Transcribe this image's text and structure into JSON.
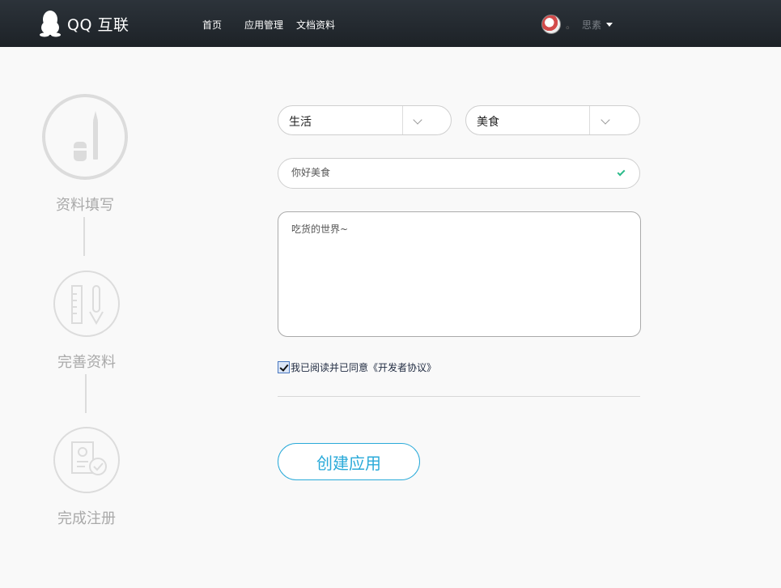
{
  "header": {
    "logo_text": "QQ 互联",
    "nav": [
      "首页",
      "应用管理",
      "文档资料"
    ],
    "user_dot": "。",
    "user_name": "思素"
  },
  "steps": [
    {
      "label": "资料填写",
      "active": true
    },
    {
      "label": "完善资料",
      "active": false
    },
    {
      "label": "完成注册",
      "active": false
    }
  ],
  "form": {
    "category_primary": "生活",
    "category_secondary": "美食",
    "app_name": "你好美食",
    "app_description": "吃货的世界~",
    "agree_label": "我已阅读并已同意《开发者协议》",
    "agree_checked": true,
    "submit_label": "创建应用"
  },
  "colors": {
    "accent": "#2aaad9",
    "valid": "#2dbb8b",
    "step_inactive": "#a9a9a9"
  }
}
